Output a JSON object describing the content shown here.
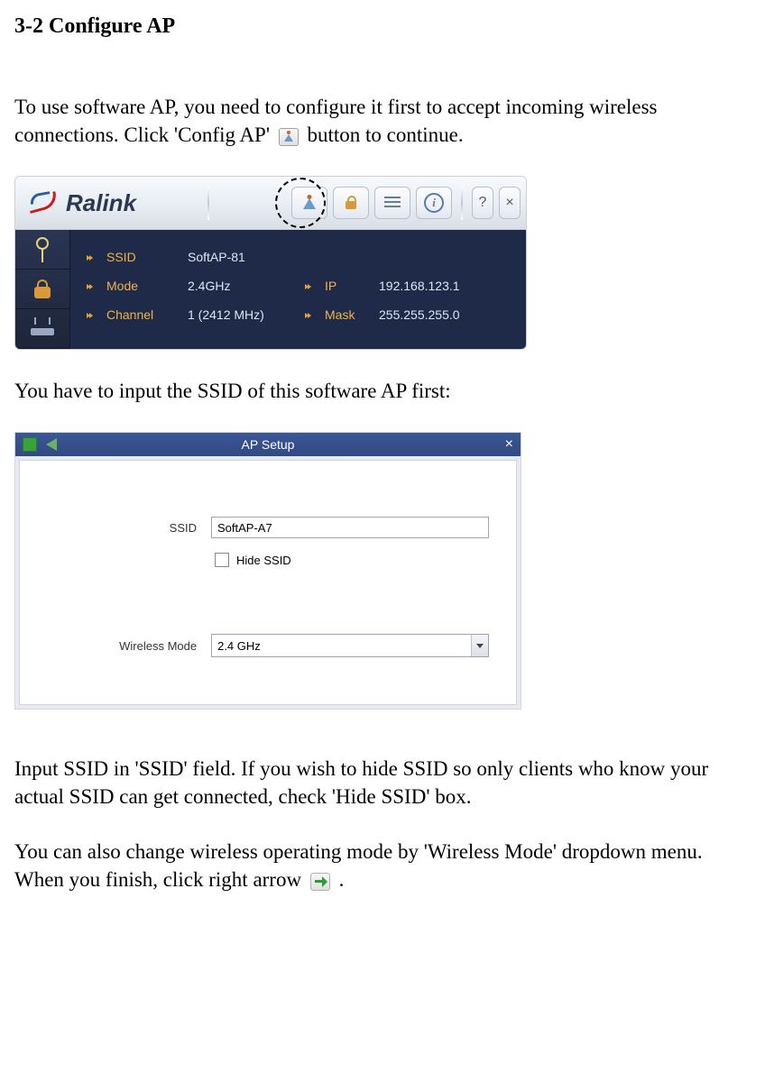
{
  "section_title": "3-2 Configure AP",
  "para1_a": "To use software AP, you need to configure it first to accept incoming wireless connections. Click 'Config AP' ",
  "para1_b": " button to continue.",
  "ralink": {
    "logo_text": "Ralink",
    "help_label": "?",
    "close_label": "×",
    "info_label": "i",
    "ssid_label": "SSID",
    "ssid_value": "SoftAP-81",
    "mode_label": "Mode",
    "mode_value": "2.4GHz",
    "channel_label": "Channel",
    "channel_value": "1 (2412 MHz)",
    "ip_label": "IP",
    "ip_value": "192.168.123.1",
    "mask_label": "Mask",
    "mask_value": "255.255.255.0"
  },
  "para2": "You have to input the SSID of this software AP first:",
  "apsetup": {
    "title": "AP Setup",
    "close": "×",
    "ssid_label": "SSID",
    "ssid_value": "SoftAP-A7",
    "hide_label": "Hide SSID",
    "mode_label": "Wireless Mode",
    "mode_value": "2.4 GHz"
  },
  "para3": "Input SSID in 'SSID' field. If you wish to hide SSID so only clients who know your actual SSID can get connected, check 'Hide SSID' box.",
  "para4_a": "You can also change wireless operating mode by 'Wireless Mode' dropdown menu. When you finish, click right arrow ",
  "para4_b": " ."
}
